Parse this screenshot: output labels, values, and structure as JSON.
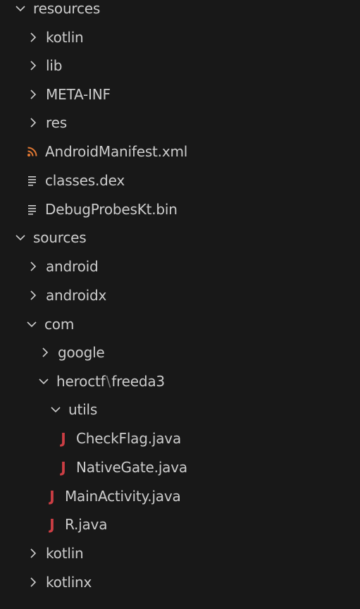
{
  "explorer": {
    "resources": {
      "label": "resources",
      "children": {
        "kotlin": "kotlin",
        "lib": "lib",
        "meta_inf": "META-INF",
        "res": "res",
        "android_manifest": "AndroidManifest.xml",
        "classes_dex": "classes.dex",
        "debug_probes": "DebugProbesKt.bin"
      }
    },
    "sources": {
      "label": "sources",
      "children": {
        "android": "android",
        "androidx": "androidx",
        "com": {
          "label": "com",
          "google": "google",
          "heroctf_part1": "heroctf",
          "separator": "\\",
          "heroctf_part2": "freeda3",
          "utils": {
            "label": "utils",
            "check_flag": "CheckFlag.java",
            "native_gate": "NativeGate.java"
          },
          "main_activity": "MainActivity.java",
          "r_java": "R.java"
        },
        "kotlin": "kotlin",
        "kotlinx": "kotlinx"
      }
    }
  },
  "icons": {
    "chevron_right": "chevron-right-icon",
    "chevron_down": "chevron-down-icon",
    "rss": "rss-icon",
    "file_lines": "file-lines-icon",
    "java": "java-icon"
  },
  "colors": {
    "background": "#181818",
    "text": "#cccccc",
    "java_icon": "#cc3e44",
    "rss_icon": "#e37933",
    "file_icon": "#cccccc"
  }
}
